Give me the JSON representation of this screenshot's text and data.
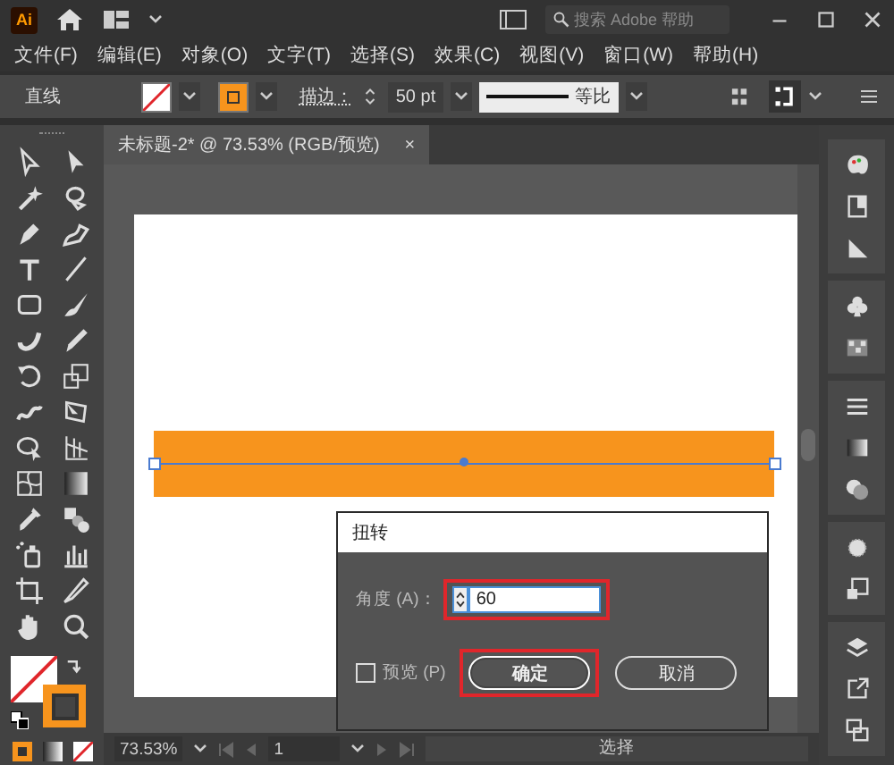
{
  "title_bar": {
    "logo": "Ai",
    "search_placeholder": "搜索 Adobe 帮助"
  },
  "menu": [
    "文件(F)",
    "编辑(E)",
    "对象(O)",
    "文字(T)",
    "选择(S)",
    "效果(C)",
    "视图(V)",
    "窗口(W)",
    "帮助(H)"
  ],
  "control_bar": {
    "selection_label": "直线",
    "stroke_label": "描边：",
    "stroke_value": "50 pt",
    "profile_label": "等比"
  },
  "tabs": [
    {
      "title": "未标题-2* @ 73.53% (RGB/预览)",
      "close": "×",
      "selected": true
    }
  ],
  "dialog": {
    "title": "扭转",
    "angle_label": "角度 (A)：",
    "angle_value": "60",
    "angle_highlighted": true,
    "preview_label": "预览 (P)",
    "preview_checked": false,
    "buttons": [
      {
        "label": "确定",
        "kind": "primary",
        "highlighted": true
      },
      {
        "label": "取消",
        "kind": "secondary",
        "highlighted": false
      }
    ]
  },
  "status_bar": {
    "zoom": "73.53%",
    "page": "1",
    "tool": "选择"
  }
}
